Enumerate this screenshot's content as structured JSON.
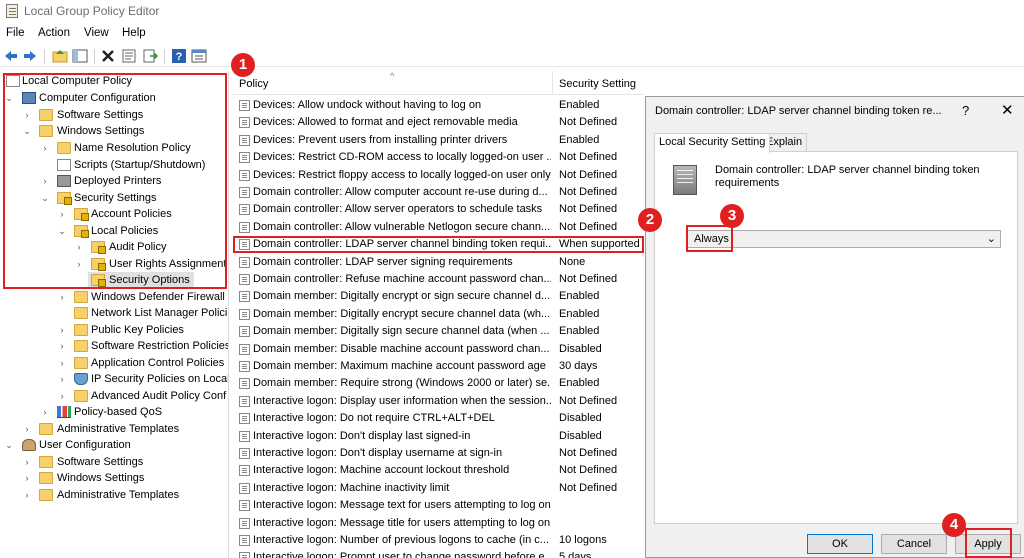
{
  "window": {
    "title": "Local Group Policy Editor"
  },
  "menu": [
    "File",
    "Action",
    "View",
    "Help"
  ],
  "toolbar": {
    "icons": [
      "back-arrow-icon",
      "forward-arrow-icon",
      "up-folder-icon",
      "show-hide-tree-icon",
      "delete-icon",
      "properties-icon",
      "export-list-icon",
      "help-icon",
      "filter-view-icon"
    ]
  },
  "tree": {
    "items": [
      {
        "label": "Local Computer Policy"
      },
      {
        "label": "Computer Configuration"
      },
      {
        "label": "Software Settings"
      },
      {
        "label": "Windows Settings"
      },
      {
        "label": "Name Resolution Policy"
      },
      {
        "label": "Scripts (Startup/Shutdown)"
      },
      {
        "label": "Deployed Printers"
      },
      {
        "label": "Security Settings"
      },
      {
        "label": "Account Policies"
      },
      {
        "label": "Local Policies"
      },
      {
        "label": "Audit Policy"
      },
      {
        "label": "User Rights Assignment"
      },
      {
        "label": "Security Options"
      },
      {
        "label": "Windows Defender Firewall w"
      },
      {
        "label": "Network List Manager Polici"
      },
      {
        "label": "Public Key Policies"
      },
      {
        "label": "Software Restriction Policies"
      },
      {
        "label": "Application Control Policies"
      },
      {
        "label": "IP Security Policies on Local"
      },
      {
        "label": "Advanced Audit Policy Conf"
      },
      {
        "label": "Policy-based QoS"
      },
      {
        "label": "Administrative Templates"
      },
      {
        "label": "User Configuration"
      },
      {
        "label": "Software Settings"
      },
      {
        "label": "Windows Settings"
      },
      {
        "label": "Administrative Templates"
      }
    ]
  },
  "list": {
    "columns": {
      "policy": "Policy",
      "setting": "Security Setting"
    },
    "rows": [
      {
        "policy": "Devices: Allow undock without having to log on",
        "setting": "Enabled"
      },
      {
        "policy": "Devices: Allowed to format and eject removable media",
        "setting": "Not Defined"
      },
      {
        "policy": "Devices: Prevent users from installing printer drivers",
        "setting": "Enabled"
      },
      {
        "policy": "Devices: Restrict CD-ROM access to locally logged-on user ...",
        "setting": "Not Defined"
      },
      {
        "policy": "Devices: Restrict floppy access to locally logged-on user only",
        "setting": "Not Defined"
      },
      {
        "policy": "Domain controller: Allow computer account re-use during d...",
        "setting": "Not Defined"
      },
      {
        "policy": "Domain controller: Allow server operators to schedule tasks",
        "setting": "Not Defined"
      },
      {
        "policy": "Domain controller: Allow vulnerable Netlogon secure chann...",
        "setting": "Not Defined"
      },
      {
        "policy": "Domain controller: LDAP server channel binding token requi...",
        "setting": "When supported"
      },
      {
        "policy": "Domain controller: LDAP server signing requirements",
        "setting": "None"
      },
      {
        "policy": "Domain controller: Refuse machine account password chan...",
        "setting": "Not Defined"
      },
      {
        "policy": "Domain member: Digitally encrypt or sign secure channel d...",
        "setting": "Enabled"
      },
      {
        "policy": "Domain member: Digitally encrypt secure channel data (wh...",
        "setting": "Enabled"
      },
      {
        "policy": "Domain member: Digitally sign secure channel data (when ...",
        "setting": "Enabled"
      },
      {
        "policy": "Domain member: Disable machine account password chan...",
        "setting": "Disabled"
      },
      {
        "policy": "Domain member: Maximum machine account password age",
        "setting": "30 days"
      },
      {
        "policy": "Domain member: Require strong (Windows 2000 or later) se...",
        "setting": "Enabled"
      },
      {
        "policy": "Interactive logon: Display user information when the session...",
        "setting": "Not Defined"
      },
      {
        "policy": "Interactive logon: Do not require CTRL+ALT+DEL",
        "setting": "Disabled"
      },
      {
        "policy": "Interactive logon: Don't display last signed-in",
        "setting": "Disabled"
      },
      {
        "policy": "Interactive logon: Don't display username at sign-in",
        "setting": "Not Defined"
      },
      {
        "policy": "Interactive logon: Machine account lockout threshold",
        "setting": "Not Defined"
      },
      {
        "policy": "Interactive logon: Machine inactivity limit",
        "setting": "Not Defined"
      },
      {
        "policy": "Interactive logon: Message text for users attempting to log on",
        "setting": ""
      },
      {
        "policy": "Interactive logon: Message title for users attempting to log on",
        "setting": ""
      },
      {
        "policy": "Interactive logon: Number of previous logons to cache (in c...",
        "setting": "10 logons"
      },
      {
        "policy": "Interactive logon: Prompt user to change password before e...",
        "setting": "5 days"
      }
    ]
  },
  "dialog": {
    "title": "Domain controller: LDAP server channel binding token re...",
    "help": "?",
    "close": "✕",
    "tabs": [
      "Local Security Setting",
      "Explain"
    ],
    "description": "Domain controller: LDAP server channel binding token requirements",
    "dropdown_value": "Always",
    "buttons": {
      "ok": "OK",
      "cancel": "Cancel",
      "apply": "Apply"
    }
  },
  "annotations": [
    "1",
    "2",
    "3",
    "4"
  ],
  "colors": {
    "annotation_red": "#e02020",
    "folder_yellow": "#f5d06b",
    "selection_gray": "#e0e0e0"
  }
}
